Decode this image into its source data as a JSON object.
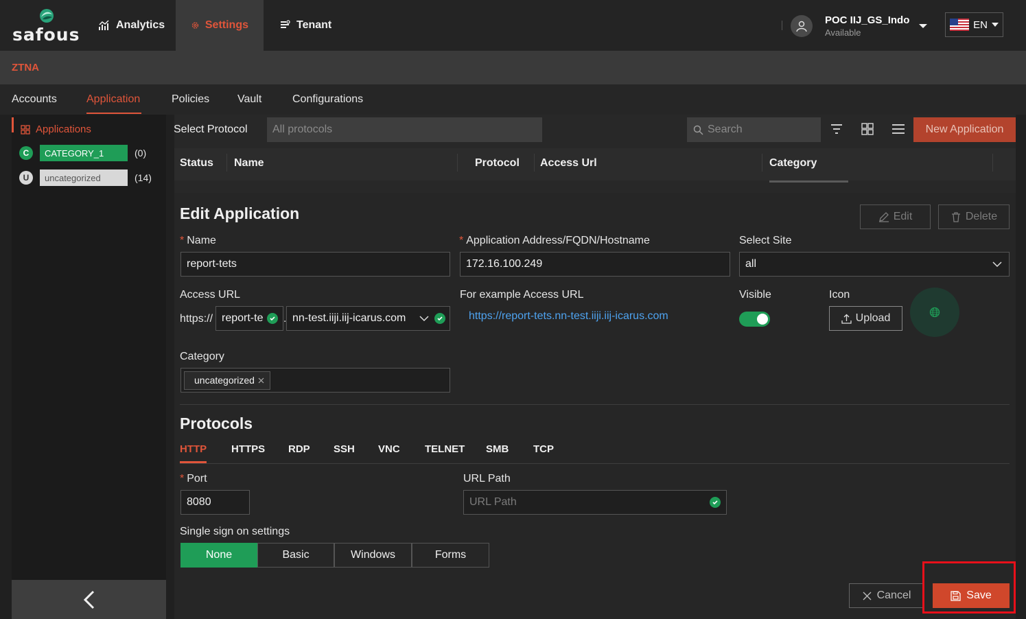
{
  "brand": {
    "name": "safous"
  },
  "topnav": {
    "analytics": "Analytics",
    "settings": "Settings",
    "tenant": "Tenant"
  },
  "user": {
    "name": "POC IIJ_GS_Indo",
    "status": "Available"
  },
  "language": {
    "code": "EN"
  },
  "section": {
    "title": "ZTNA"
  },
  "subtabs": [
    "Accounts",
    "Application",
    "Policies",
    "Vault",
    "Configurations"
  ],
  "sidebar": {
    "header": "Applications",
    "categories": [
      {
        "badge": "C",
        "label": "CATEGORY_1",
        "count": "(0)",
        "color": "#1f9d57"
      },
      {
        "badge": "U",
        "label": "uncategorized",
        "count": "(14)",
        "color": "#d8d8d8"
      }
    ]
  },
  "toolbar": {
    "select_protocol_label": "Select Protocol",
    "protocol_placeholder": "All protocols",
    "search_placeholder": "Search",
    "new_application": "New Application"
  },
  "table": {
    "columns": [
      "Status",
      "Name",
      "Protocol",
      "Access Url",
      "Category"
    ]
  },
  "edit": {
    "title": "Edit Application",
    "edit_button": "Edit",
    "delete_button": "Delete",
    "name_label": "Name",
    "name_value": "report-tets",
    "address_label": "Application Address/FQDN/Hostname",
    "address_value": "172.16.100.249",
    "site_label": "Select Site",
    "site_value": "all",
    "access_url_label": "Access URL",
    "access_prefix": "https://",
    "access_sub": "report-te",
    "access_dot": ".",
    "access_domain": "nn-test.iiji.iij-icarus.com",
    "example_label": "For example Access URL",
    "example_url": "https://report-tets.nn-test.iiji.iij-icarus.com",
    "visible_label": "Visible",
    "visible_on": true,
    "icon_label": "Icon",
    "upload_button": "Upload",
    "category_label": "Category",
    "category_tag": "uncategorized"
  },
  "protocols": {
    "title": "Protocols",
    "tabs": [
      "HTTP",
      "HTTPS",
      "RDP",
      "SSH",
      "VNC",
      "TELNET",
      "SMB",
      "TCP"
    ],
    "active_tab": "HTTP",
    "port_label": "Port",
    "port_value": "8080",
    "url_path_label": "URL Path",
    "url_path_placeholder": "URL Path",
    "sso_label": "Single sign on settings",
    "sso_options": [
      "None",
      "Basic",
      "Windows",
      "Forms"
    ],
    "sso_selected": "None"
  },
  "actions": {
    "cancel": "Cancel",
    "save": "Save"
  },
  "colors": {
    "accent": "#e0553a",
    "success": "#1f9d57",
    "highlight": "#e8101a"
  }
}
